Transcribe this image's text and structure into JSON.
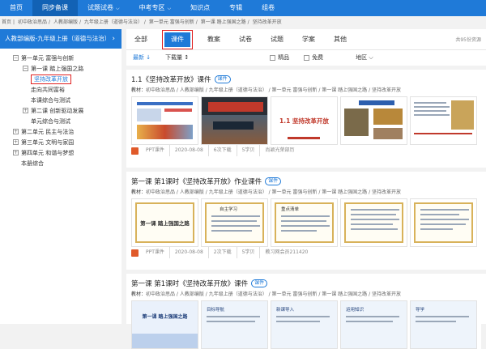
{
  "nav": {
    "items": [
      {
        "label": "首页"
      },
      {
        "label": "同步备课",
        "active": true
      },
      {
        "label": "试题试卷",
        "caret": "⌵"
      },
      {
        "label": "中考专区",
        "caret": "⌵"
      },
      {
        "label": "知识点"
      },
      {
        "label": "专辑"
      },
      {
        "label": "组卷"
      }
    ]
  },
  "breadcrumb": [
    "首页",
    "初中政治思品",
    "人教部编版",
    "九年级上册（道德与法治）",
    "第一单元 富强与创新",
    "第一课 踏上强国之路",
    "坚持改革开放"
  ],
  "sidebar": {
    "header": "人教部编版-九年级上册（道德与法治）",
    "header_icon": "chevron-right-icon",
    "tree": [
      {
        "label": "第一单元 富强与创新",
        "level": 1,
        "toggle": "⊟"
      },
      {
        "label": "第一课 踏上强国之路",
        "level": 2,
        "toggle": "⊟"
      },
      {
        "label": "坚持改革开放",
        "level": 3,
        "selected": true
      },
      {
        "label": "走向共同富裕",
        "level": 3
      },
      {
        "label": "本课综合与测试",
        "level": 3
      },
      {
        "label": "第二课 创新驱动发展",
        "level": 2,
        "toggle": "⊞"
      },
      {
        "label": "单元综合与测试",
        "level": 2
      },
      {
        "label": "第二单元 民主与法治",
        "level": 1,
        "toggle": "⊞"
      },
      {
        "label": "第三单元 文明与家园",
        "level": 1,
        "toggle": "⊞"
      },
      {
        "label": "第四单元 和谐与梦想",
        "level": 1,
        "toggle": "⊞"
      },
      {
        "label": "本册综合",
        "level": 1
      }
    ]
  },
  "tabs": {
    "items": [
      {
        "label": "全部"
      },
      {
        "label": "课件",
        "active": true
      },
      {
        "label": "教案"
      },
      {
        "label": "试卷"
      },
      {
        "label": "试题"
      },
      {
        "label": "学案"
      },
      {
        "label": "其他"
      }
    ],
    "count": "共95份资源"
  },
  "filters": {
    "newest": "最新 ↓",
    "downloads": "下载量 ↕",
    "premium": "精品",
    "free": "免费",
    "region": "地区 ⌵"
  },
  "cards": [
    {
      "title": "1.1《坚持改革开放》课件",
      "badge": "课件",
      "path_label": "教材：",
      "path": "初中政治思品 / 人教部编版 / 九年级上册（道德与法治） / 第一单元 富强与创新 / 第一课 踏上强国之路 / 坚持改革开放",
      "type": "PPT课件",
      "date": "2020-08-08",
      "pages": "6次下载",
      "points": "5学贝",
      "author": "尚颖光荣部历",
      "thumb_text": [
        "坚持改革开放",
        "1.1 坚持改革开放"
      ]
    },
    {
      "title": "第一课 第1课时《坚持改革开放》作业课件",
      "badge": "课件",
      "path_label": "教材：",
      "path": "初中政治思品 / 人教部编版 / 九年级上册（道德与法治） / 第一单元 富强与创新 / 第一课 踏上强国之路 / 坚持改革开放",
      "type": "PPT课件",
      "date": "2020-08-08",
      "pages": "2次下载",
      "points": "5学贝",
      "author": "教习网会员211420",
      "thumb_text": [
        "第一课 踏上强国之路",
        "自主学习",
        "重点清单"
      ]
    },
    {
      "title": "第一课 第1课时《坚持改革开放》课件",
      "badge": "课件",
      "path_label": "教材：",
      "path": "初中政治思品 / 人教部编版 / 九年级上册（道德与法治） / 第一单元 富强与创新 / 第一课 踏上强国之路 / 坚持改革开放",
      "thumb_text": [
        "第一课 踏上强国之路",
        "目标导航",
        "新课导入",
        "运用知识",
        "导学"
      ]
    }
  ]
}
